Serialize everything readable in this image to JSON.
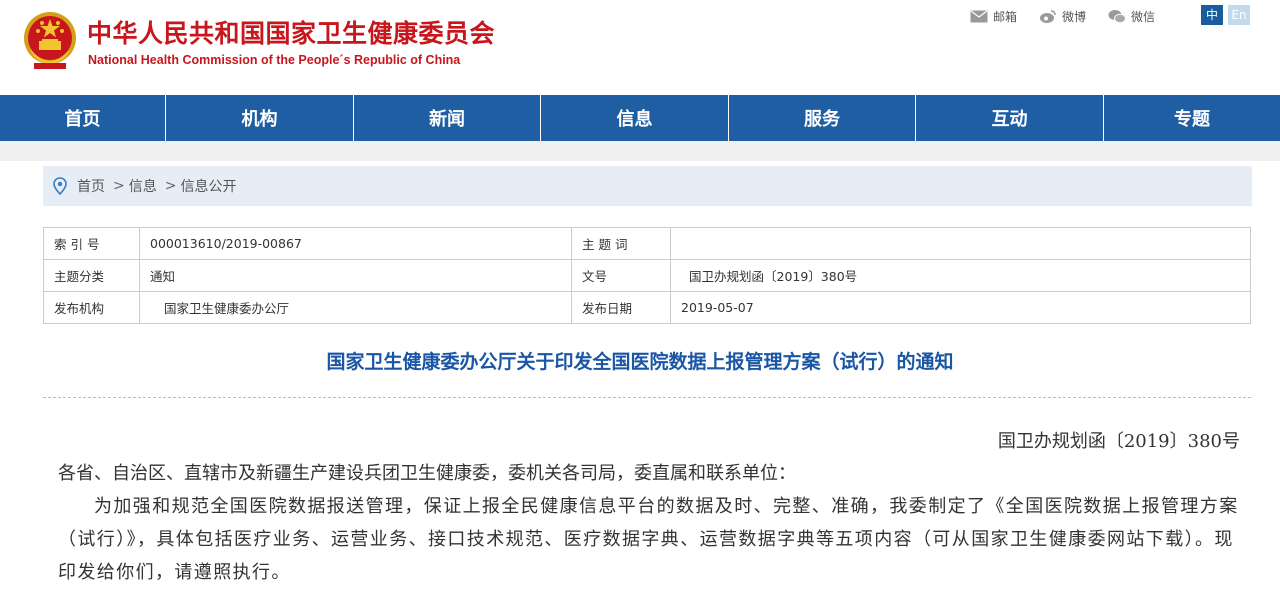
{
  "header": {
    "title_cn": "中华人民共和国国家卫生健康委员会",
    "title_en": "National Health Commission of the People´s Republic of China",
    "links": [
      {
        "label": "邮箱",
        "icon": "mail-icon"
      },
      {
        "label": "微博",
        "icon": "weibo-icon"
      },
      {
        "label": "微信",
        "icon": "wechat-icon"
      }
    ],
    "lang_zh": "中",
    "lang_en": "En"
  },
  "nav": {
    "items": [
      "首页",
      "机构",
      "新闻",
      "信息",
      "服务",
      "互动",
      "专题"
    ]
  },
  "breadcrumb": {
    "items": [
      "首页",
      "信息",
      "信息公开"
    ],
    "separator": ">"
  },
  "meta": {
    "index_label": "索 引 号",
    "index_value": "000013610/2019-00867",
    "keywords_label": "主 题 词",
    "keywords_value": "",
    "category_label": "主题分类",
    "category_value": "通知",
    "docno_label": "文号",
    "docno_value": "国卫办规划函〔2019〕380号",
    "issuer_label": "发布机构",
    "issuer_value": "国家卫生健康委办公厅",
    "date_label": "发布日期",
    "date_value": "2019-05-07"
  },
  "document": {
    "title": "国家卫生健康委办公厅关于印发全国医院数据上报管理方案（试行）的通知",
    "number": "国卫办规划函〔2019〕380号",
    "recipient": "各省、自治区、直辖市及新疆生产建设兵团卫生健康委，委机关各司局，委直属和联系单位：",
    "paragraph": "为加强和规范全国医院数据报送管理，保证上报全民健康信息平台的数据及时、完整、准确，我委制定了《全国医院数据上报管理方案（试行）》，具体包括医疗业务、运营业务、接口技术规范、医疗数据字典、运营数据字典等五项内容（可从国家卫生健康委网站下载）。现印发给你们，请遵照执行。"
  },
  "colors": {
    "brand_red": "#c8161d",
    "nav_blue": "#1f5ea3",
    "title_blue": "#1a56a5"
  }
}
